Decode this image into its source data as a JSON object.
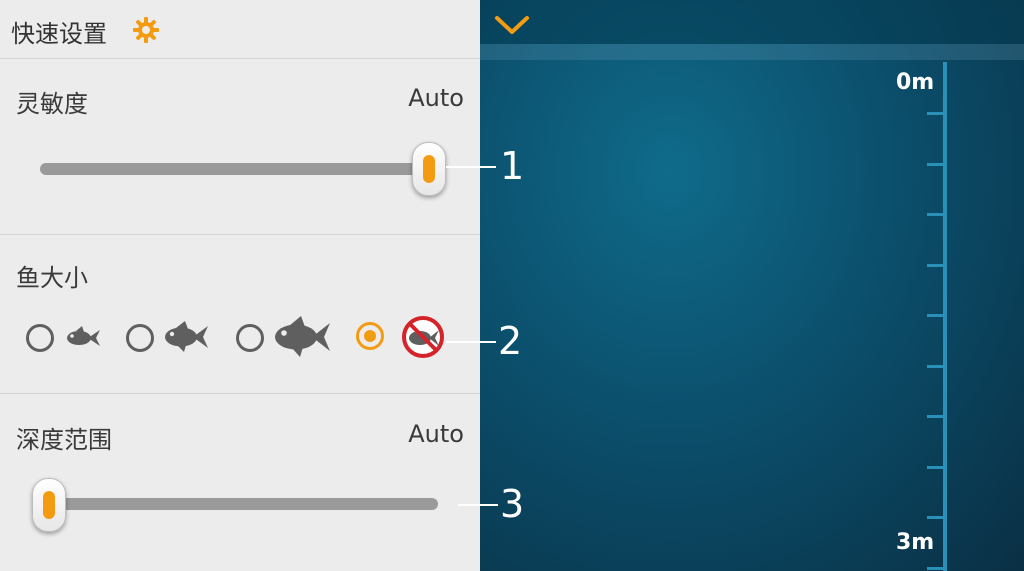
{
  "panel": {
    "title": "快速设置",
    "icon": "gear-icon",
    "accent_color": "#f39c12"
  },
  "sensitivity": {
    "label": "灵敏度",
    "value": "Auto",
    "level": 1.0
  },
  "fish_size": {
    "label": "鱼大小",
    "options": [
      {
        "name": "small-fish",
        "selected": false
      },
      {
        "name": "medium-fish",
        "selected": false
      },
      {
        "name": "large-fish",
        "selected": false
      },
      {
        "name": "no-fish",
        "selected": true
      }
    ]
  },
  "depth_range": {
    "label": "深度范围",
    "value": "Auto",
    "level": 0.0
  },
  "sonar": {
    "top_depth": "0m",
    "bottom_depth": "3m",
    "collapse_icon": "chevron-down-icon"
  },
  "callouts": [
    "1",
    "2",
    "3"
  ]
}
